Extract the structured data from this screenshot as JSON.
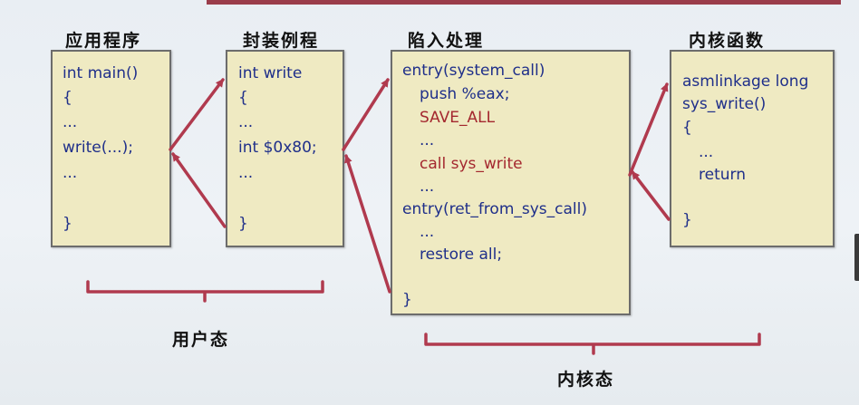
{
  "titles": {
    "app": "应用程序",
    "wrapper": "封装例程",
    "trap": "陷入处理",
    "kernel": "内核函数"
  },
  "app_box": {
    "line1": "int main()",
    "line2": "{",
    "line3": "...",
    "line4": "write(...);",
    "line5": "...",
    "line6": "}"
  },
  "wrapper_box": {
    "line1": "int write",
    "line2": "{",
    "line3": "...",
    "line4": "int $0x80;",
    "line5": "...",
    "line6": "}"
  },
  "trap_box": {
    "line1": "entry(system_call)",
    "line2": "push %eax;",
    "line3": "SAVE_ALL",
    "line4": "...",
    "line5": "call sys_write",
    "line6": "...",
    "line7": "entry(ret_from_sys_call)",
    "line8": "...",
    "line9": "restore all;",
    "line10": "}"
  },
  "kernel_box": {
    "line1": "asmlinkage long",
    "line2": "sys_write()",
    "line3": "{",
    "line4": "...",
    "line5": "return",
    "line6": "}"
  },
  "labels": {
    "user_mode": "用户态",
    "kernel_mode": "内核态"
  },
  "colors": {
    "code_text": "#1f2f8a",
    "highlight_text": "#a4282f",
    "box_fill": "#efeac2",
    "arrow": "#b03a4e"
  }
}
